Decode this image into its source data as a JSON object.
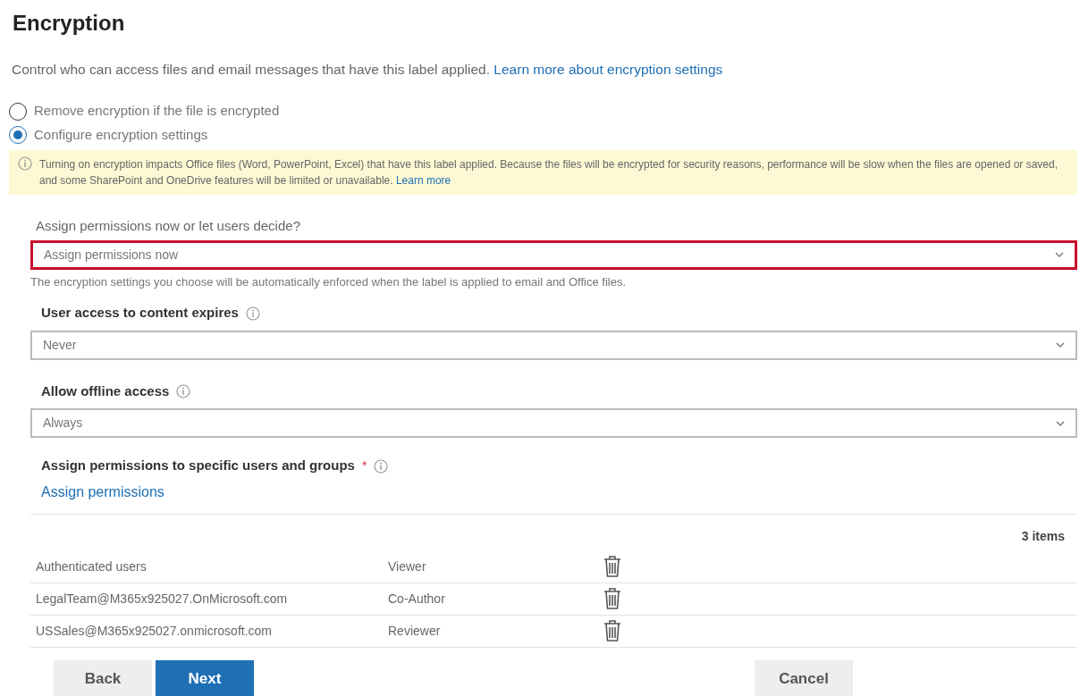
{
  "title": "Encryption",
  "description": "Control who can access files and email messages that have this label applied.",
  "description_link": "Learn more about encryption settings",
  "options": [
    {
      "label": "Remove encryption if the file is encrypted",
      "selected": false
    },
    {
      "label": "Configure encryption settings",
      "selected": true
    }
  ],
  "notice": {
    "text": "Turning on encryption impacts Office files (Word, PowerPoint, Excel) that have this label applied. Because the files will be encrypted for security reasons, performance will be slow when the files are opened or saved, and some SharePoint and OneDrive features will be limited or unavailable.",
    "link": "Learn more"
  },
  "assign_mode": {
    "label": "Assign permissions now or let users decide?",
    "value": "Assign permissions now",
    "highlighted": true,
    "help": "The encryption settings you choose will be automatically enforced when the label is applied to email and Office files."
  },
  "settings": [
    {
      "label": "User access to content expires",
      "value": "Never"
    },
    {
      "label": "Allow offline access",
      "value": "Always"
    }
  ],
  "permissions": {
    "label": "Assign permissions to specific users and groups",
    "required_mark": "*",
    "link": "Assign permissions",
    "count": "3 items",
    "rows": [
      {
        "user": "Authenticated users",
        "role": "Viewer"
      },
      {
        "user": "LegalTeam@M365x925027.OnMicrosoft.com",
        "role": "Co-Author"
      },
      {
        "user": "USSales@M365x925027.onmicrosoft.com",
        "role": "Reviewer"
      }
    ]
  },
  "buttons": [
    {
      "label": "Back",
      "kind": "secondary"
    },
    {
      "label": "Next",
      "kind": "primary"
    },
    {
      "label": "Cancel",
      "kind": "secondary"
    }
  ]
}
